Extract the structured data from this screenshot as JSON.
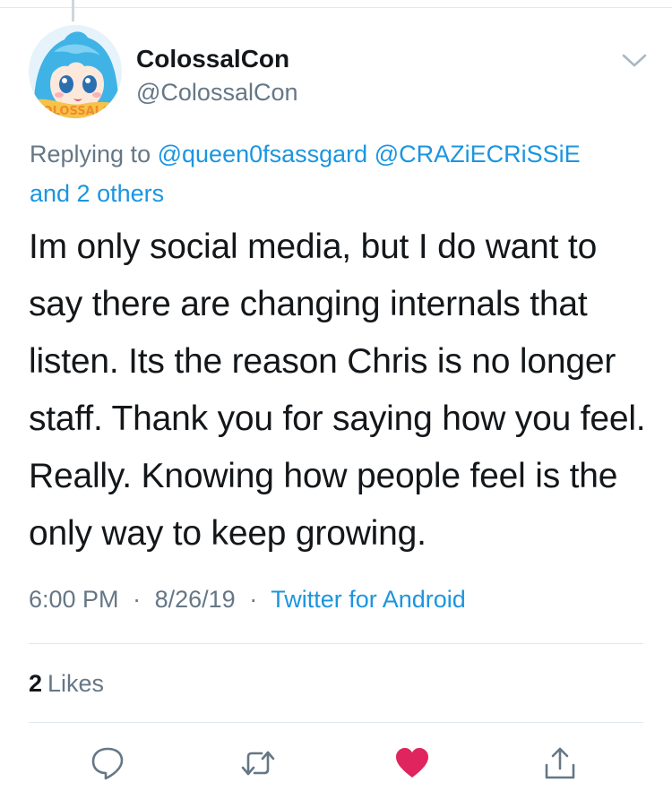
{
  "tweet": {
    "author": {
      "name": "ColossalCon",
      "handle": "@ColossalCon",
      "avatar_text": "COLOSSALCON"
    },
    "replying": {
      "prefix": "Replying to",
      "mentions": [
        "@queen0fsassgard",
        "@CRAZiECRiSSiE"
      ],
      "others": "and 2 others"
    },
    "text": "Im only social media, but I do want to say there are changing internals that listen. Its the reason Chris is no longer staff. Thank you for saying how you feel. Really. Knowing how people feel is the only way to keep growing.",
    "meta": {
      "time": "6:00 PM",
      "date": "8/26/19",
      "source": "Twitter for Android",
      "separator": "·"
    },
    "likes": {
      "count": "2",
      "label": "Likes"
    }
  },
  "icons": {
    "more": "chevron-down-icon",
    "reply": "reply-icon",
    "retweet": "retweet-icon",
    "like": "heart-icon",
    "share": "share-icon"
  },
  "colors": {
    "link": "#1b95e0",
    "secondary": "#657786",
    "like": "#e0245e",
    "text": "#14171a"
  }
}
